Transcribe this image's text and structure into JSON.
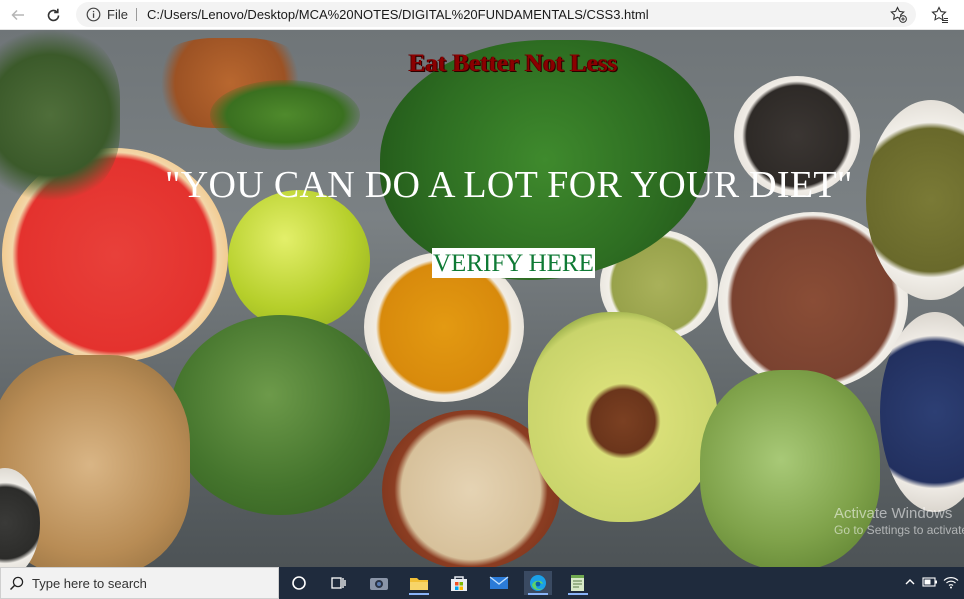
{
  "browser": {
    "address_bar": {
      "scheme_label": "File",
      "url": "C:/Users/Lenovo/Desktop/MCA%20NOTES/DIGITAL%20FUNDAMENTALS/CSS3.html"
    },
    "icons": [
      "back-arrow-icon",
      "refresh-icon",
      "info-icon",
      "add-favorite-icon",
      "favorites-icon"
    ]
  },
  "page": {
    "headline": "Eat Better Not Less",
    "quote": "\"YOU CAN DO A LOT FOR YOUR DIET\"",
    "verify_button": "VERIFY HERE",
    "colors": {
      "headline": "#8b0000",
      "quote": "#ffffff",
      "verify_text": "#0f7a35",
      "verify_bg": "#ffffff"
    }
  },
  "os_watermark": {
    "title": "Activate Windows",
    "subtitle": "Go to Settings to activate"
  },
  "taskbar": {
    "search_placeholder": "Type here to search",
    "apps": [
      "cortana-icon",
      "task-view-icon",
      "camera-icon",
      "file-explorer-icon",
      "store-icon",
      "mail-icon",
      "edge-icon",
      "notepad-icon"
    ],
    "tray": [
      "chevron-up-icon",
      "battery-icon",
      "wifi-icon"
    ]
  }
}
